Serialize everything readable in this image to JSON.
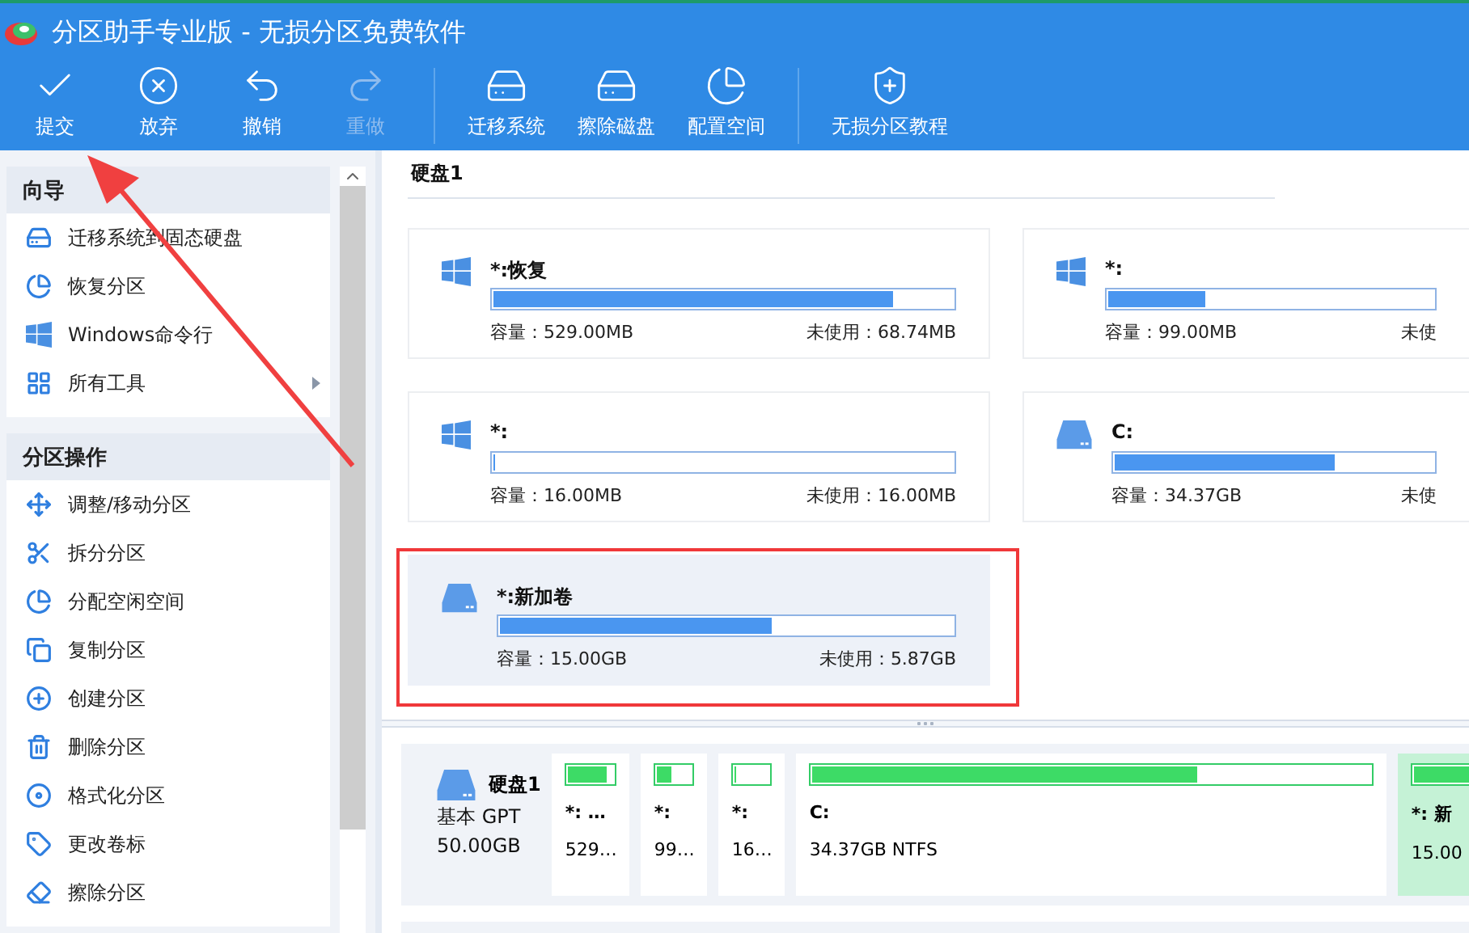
{
  "window": {
    "title": "分区助手专业版 - 无损分区免费软件"
  },
  "toolbar": [
    {
      "kind": "button",
      "label": "提交",
      "disabled": false
    },
    {
      "kind": "button",
      "label": "放弃",
      "disabled": false
    },
    {
      "kind": "button",
      "label": "撤销",
      "disabled": false
    },
    {
      "kind": "button",
      "label": "重做",
      "disabled": true
    },
    {
      "kind": "separator"
    },
    {
      "kind": "button",
      "label": "迁移系统",
      "disabled": false
    },
    {
      "kind": "button",
      "label": "擦除磁盘",
      "disabled": false
    },
    {
      "kind": "button",
      "label": "配置空间",
      "disabled": false
    },
    {
      "kind": "separator"
    },
    {
      "kind": "button",
      "label": "无损分区教程",
      "disabled": false
    }
  ],
  "sidebar": {
    "sections": [
      {
        "title": "向导",
        "items": [
          {
            "label": "迁移系统到固态硬盘",
            "submenu": false
          },
          {
            "label": "恢复分区",
            "submenu": false
          },
          {
            "label": "Windows命令行",
            "submenu": false
          },
          {
            "label": "所有工具",
            "submenu": true
          }
        ]
      },
      {
        "title": "分区操作",
        "items": [
          {
            "label": "调整/移动分区",
            "submenu": false
          },
          {
            "label": "拆分分区",
            "submenu": false
          },
          {
            "label": "分配空闲空间",
            "submenu": false
          },
          {
            "label": "复制分区",
            "submenu": false
          },
          {
            "label": "创建分区",
            "submenu": false
          },
          {
            "label": "删除分区",
            "submenu": false
          },
          {
            "label": "格式化分区",
            "submenu": false
          },
          {
            "label": "更改卷标",
            "submenu": false
          },
          {
            "label": "擦除分区",
            "submenu": false
          }
        ]
      }
    ]
  },
  "disk_panel": {
    "title": "硬盘1",
    "partitions": [
      {
        "name": "*:恢复",
        "level": 0.87,
        "capacity": "容量：529.00MB",
        "unused": "未使用：68.74MB",
        "selected": false
      },
      {
        "name": "*:",
        "level": 0.3,
        "capacity": "容量：99.00MB",
        "unused": "未使",
        "selected": false
      },
      {
        "name": "*:",
        "level": 0,
        "capacity": "容量：16.00MB",
        "unused": "未使用：16.00MB",
        "selected": false
      },
      {
        "name": "C:",
        "level": 0.69,
        "capacity": "容量：34.37GB",
        "unused": "未使",
        "selected": false
      },
      {
        "name": "*:新加卷",
        "level": 0.6,
        "capacity": "容量：15.00GB",
        "unused": "未使用：5.87GB",
        "selected": true
      }
    ]
  },
  "disk_map": {
    "name": "硬盘1",
    "type": "基本 GPT",
    "size": "50.00GB",
    "partitions": [
      {
        "name": "*: …",
        "info": "529…",
        "level": 0.85,
        "selected": false
      },
      {
        "name": "*:",
        "info": "99…",
        "level": 0.4,
        "selected": false
      },
      {
        "name": "*:",
        "info": "16…",
        "level": 0,
        "selected": false
      },
      {
        "name": "C:",
        "info": "34.37GB NTFS",
        "level": 0.69,
        "selected": false
      },
      {
        "name": "*: 新",
        "info": "15.00",
        "level": 0.9,
        "selected": true
      }
    ]
  }
}
